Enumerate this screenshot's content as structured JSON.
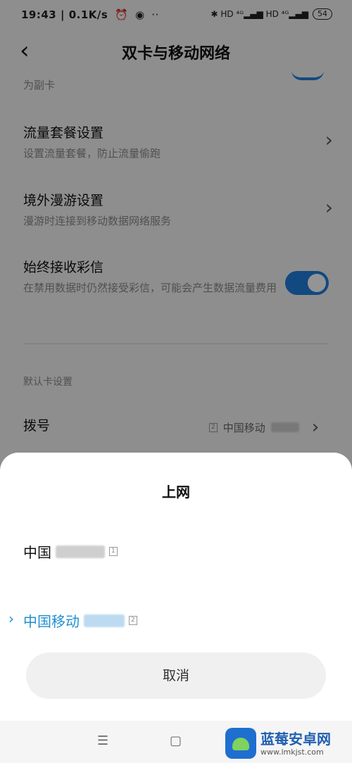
{
  "status_bar": {
    "time": "19:43",
    "speed": "0.1K/s",
    "battery": "54",
    "right_icons": "✱ HD ⁴ᴳ▂▄▆ HD ⁴ᴳ▂▄▆"
  },
  "header": {
    "back_glyph": "‹",
    "title": "双卡与移动网络"
  },
  "settings": {
    "partial_text": "为副卡",
    "rows": [
      {
        "title": "流量套餐设置",
        "subtitle": "设置流量套餐，防止流量偷跑"
      },
      {
        "title": "境外漫游设置",
        "subtitle": "漫游时连接到移动数据网络服务"
      },
      {
        "title": "始终接收彩信",
        "subtitle": "在禁用数据时仍然接受彩信，可能会产生数据流量费用",
        "toggle_on": true
      }
    ],
    "section_label": "默认卡设置",
    "dial": {
      "label": "拨号",
      "sim": "2",
      "carrier": "中国移动"
    }
  },
  "sheet": {
    "title": "上网",
    "options": [
      {
        "carrier": "中国",
        "sim": "1",
        "selected": false
      },
      {
        "carrier": "中国移动",
        "sim": "2",
        "selected": true
      }
    ],
    "cancel": "取消"
  },
  "nav": {
    "menu": "☰",
    "home": "▢"
  },
  "watermark": {
    "name": "蓝莓安卓网",
    "url": "www.lmkjst.com"
  },
  "colors": {
    "accent": "#1f7fdc",
    "selected": "#1f8fd0"
  }
}
